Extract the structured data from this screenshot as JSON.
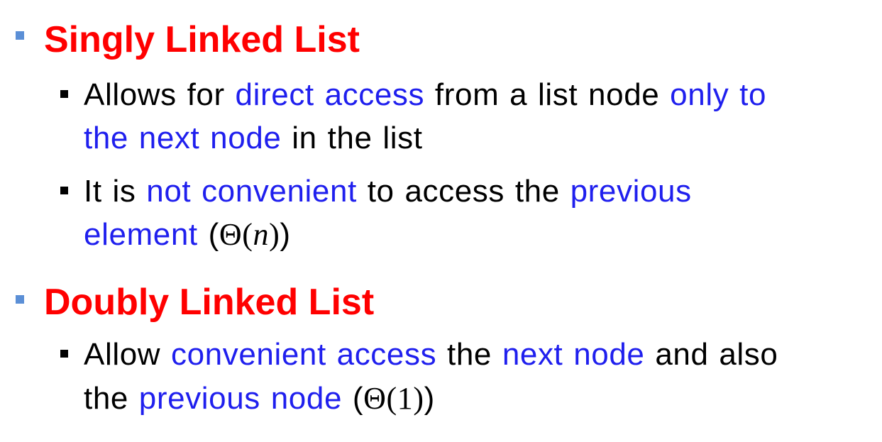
{
  "colors": {
    "heading": "#ff0000",
    "emphasis": "#1f1fee",
    "body": "#000000",
    "level1_bullet": "#5b8fd6",
    "level2_bullet": "#000000"
  },
  "sections": [
    {
      "heading": "Singly Linked List",
      "bullets": [
        {
          "lines": [
            [
              {
                "text": "Allows for ",
                "style": "normal"
              },
              {
                "text": "direct access",
                "style": "emphasis"
              },
              {
                "text": " from a list node ",
                "style": "normal"
              },
              {
                "text": "only to",
                "style": "emphasis"
              }
            ],
            [
              {
                "text": "the next node",
                "style": "emphasis"
              },
              {
                "text": " in the list",
                "style": "normal"
              }
            ]
          ]
        },
        {
          "lines": [
            [
              {
                "text": "It is ",
                "style": "normal"
              },
              {
                "text": "not convenient",
                "style": "emphasis"
              },
              {
                "text": " to access the ",
                "style": "normal"
              },
              {
                "text": "previous",
                "style": "emphasis"
              }
            ],
            [
              {
                "text": "element",
                "style": "emphasis"
              },
              {
                "text": " (",
                "style": "normal"
              },
              {
                "text": "Θ(",
                "style": "math"
              },
              {
                "text": "n",
                "style": "math-italic"
              },
              {
                "text": ")",
                "style": "math"
              },
              {
                "text": ")",
                "style": "normal"
              }
            ]
          ]
        }
      ]
    },
    {
      "heading": "Doubly Linked List",
      "bullets": [
        {
          "lines": [
            [
              {
                "text": "Allow ",
                "style": "normal"
              },
              {
                "text": "convenient access",
                "style": "emphasis"
              },
              {
                "text": " the ",
                "style": "normal"
              },
              {
                "text": "next node",
                "style": "emphasis"
              },
              {
                "text": " and also",
                "style": "normal"
              }
            ],
            [
              {
                "text": "the ",
                "style": "normal"
              },
              {
                "text": "previous node",
                "style": "emphasis"
              },
              {
                "text": " (",
                "style": "normal"
              },
              {
                "text": "Θ(1)",
                "style": "math"
              },
              {
                "text": ")",
                "style": "normal"
              }
            ]
          ]
        }
      ]
    }
  ]
}
